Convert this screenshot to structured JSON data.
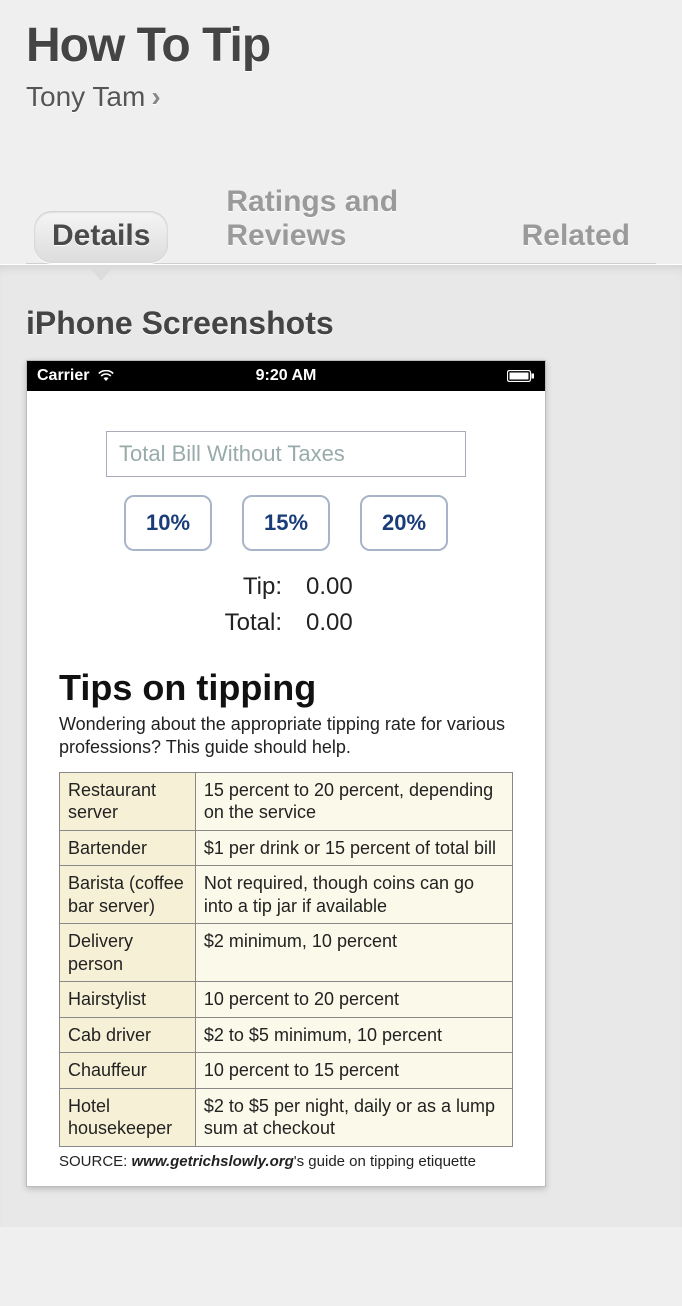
{
  "header": {
    "app_title": "How To Tip",
    "author": "Tony Tam",
    "chevron": "›"
  },
  "tabs": [
    {
      "label": "Details",
      "active": true
    },
    {
      "label": "Ratings and Reviews",
      "active": false
    },
    {
      "label": "Related",
      "active": false
    }
  ],
  "section": {
    "heading": "iPhone Screenshots"
  },
  "screenshot": {
    "status_bar": {
      "carrier": "Carrier",
      "time": "9:20 AM"
    },
    "bill_placeholder": "Total Bill Without Taxes",
    "percent_buttons": [
      "10%",
      "15%",
      "20%"
    ],
    "tip_label": "Tip:",
    "tip_value": "0.00",
    "total_label": "Total:",
    "total_value": "0.00",
    "tips_title": "Tips on tipping",
    "tips_sub": "Wondering about the appropriate tipping rate for various professions? This guide should help.",
    "tips_rows": [
      {
        "role": "Restaurant server",
        "rate": "15 percent to 20 percent, depending on the service"
      },
      {
        "role": "Bartender",
        "rate": "$1 per drink or 15 percent of total bill"
      },
      {
        "role": "Barista (coffee bar server)",
        "rate": "Not required, though coins can go into a tip jar if available"
      },
      {
        "role": "Delivery person",
        "rate": "$2 minimum, 10 percent"
      },
      {
        "role": "Hairstylist",
        "rate": "10 percent to 20 percent"
      },
      {
        "role": "Cab driver",
        "rate": "$2 to $5 minimum, 10 percent"
      },
      {
        "role": "Chauffeur",
        "rate": "10 percent to 15 percent"
      },
      {
        "role": "Hotel housekeeper",
        "rate": "$2 to $5 per night, daily or as a lump sum at checkout"
      }
    ],
    "source_prefix": "SOURCE: ",
    "source_site": "www.getrichslowly.org",
    "source_suffix": "'s guide on tipping etiquette"
  }
}
